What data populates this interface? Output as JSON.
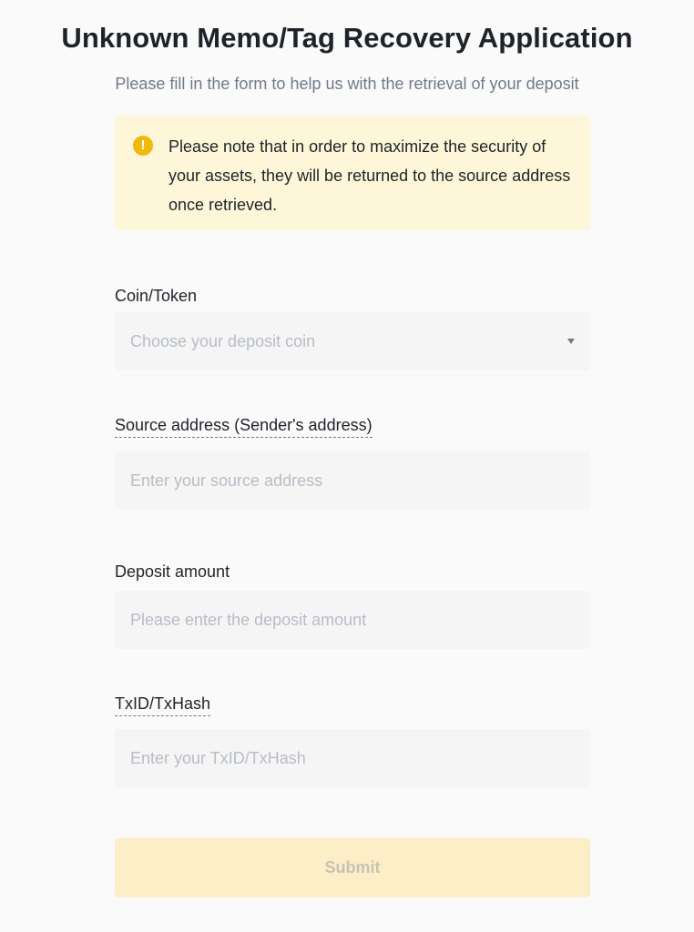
{
  "header": {
    "title": "Unknown Memo/Tag Recovery Application",
    "subtitle": "Please fill in the form to help us with the retrieval of your deposit"
  },
  "notice": {
    "icon": "warning-icon",
    "text": "Please note that in order to maximize the security of your assets, they will be returned to the source address once retrieved."
  },
  "form": {
    "coin": {
      "label": "Coin/Token",
      "placeholder": "Choose your deposit coin",
      "icon": "caret-down-icon"
    },
    "source_address": {
      "label": "Source address (Sender's address)",
      "placeholder": "Enter your source address"
    },
    "deposit_amount": {
      "label": "Deposit amount",
      "placeholder": "Please enter the deposit amount"
    },
    "txid": {
      "label": "TxID/TxHash",
      "placeholder": "Enter your TxID/TxHash"
    },
    "submit_label": "Submit"
  },
  "colors": {
    "accent": "#f0b90b",
    "notice_background": "#fef6d8",
    "submit_disabled": "#fcefc7",
    "field_background": "#f5f5f5"
  }
}
